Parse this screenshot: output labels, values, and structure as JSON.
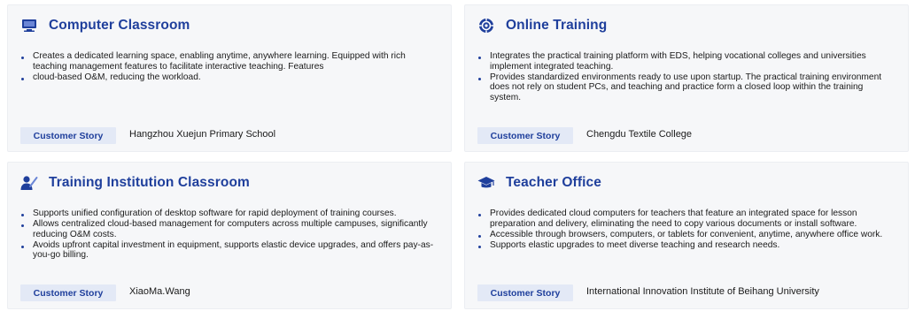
{
  "colors": {
    "accent": "#1f3f9c",
    "card_background": "#f6f7f9",
    "story_button_background": "#e3e9f6"
  },
  "cards": [
    {
      "icon": "monitor-icon",
      "title": "Computer Classroom",
      "bullets": [
        "Creates a dedicated learning space, enabling anytime, anywhere learning. Equipped with rich teaching management features to facilitate interactive teaching. Features",
        "cloud-based O&M, reducing the workload."
      ],
      "story_label": "Customer Story",
      "story_name": "Hangzhou Xuejun Primary School"
    },
    {
      "icon": "globe-icon",
      "title": "Online Training",
      "bullets": [
        "Integrates the practical training platform with EDS, helping vocational colleges and universities implement integrated teaching.",
        "Provides standardized environments ready to use upon startup. The practical training environment does not rely on student PCs, and teaching and practice form a closed loop within the training system."
      ],
      "story_label": "Customer Story",
      "story_name": "Chengdu Textile College"
    },
    {
      "icon": "instructor-icon",
      "title": "Training Institution Classroom",
      "bullets": [
        "Supports unified configuration of desktop software for rapid deployment of training courses.",
        "Allows centralized cloud-based management for computers across multiple campuses, significantly reducing O&M costs.",
        "Avoids upfront capital investment in equipment, supports elastic device upgrades, and offers pay-as-you-go billing."
      ],
      "story_label": "Customer Story",
      "story_name": "XiaoMa.Wang"
    },
    {
      "icon": "graduation-cap-icon",
      "title": "Teacher Office",
      "bullets": [
        "Provides dedicated cloud computers for teachers that feature an integrated space for lesson preparation and delivery, eliminating the need to copy various documents or install software.",
        "Accessible through browsers, computers, or tablets for convenient, anytime, anywhere office work.",
        "Supports elastic upgrades to meet diverse teaching and research needs."
      ],
      "story_label": "Customer Story",
      "story_name": "International Innovation Institute of Beihang University"
    }
  ]
}
